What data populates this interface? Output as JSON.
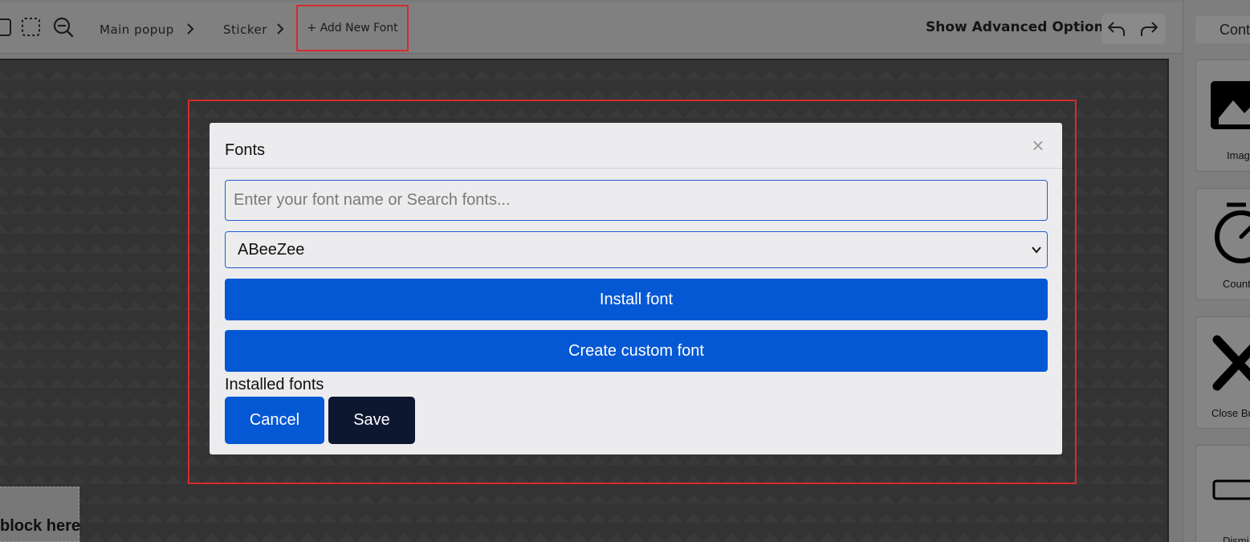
{
  "toolbar": {
    "breadcrumbs": [
      "Main popup",
      "Sticker"
    ],
    "add_font_label": "+ Add New Font",
    "advanced_label": "Show Advanced Options",
    "icons": [
      "square-icon",
      "marquee-select-icon",
      "zoom-out-icon",
      "undo-icon",
      "redo-icon"
    ]
  },
  "canvas": {
    "drop_block_text": "block here"
  },
  "sidebar": {
    "tab_label": "Cont",
    "items": [
      {
        "label": "Image",
        "icon": "image-icon"
      },
      {
        "label": "Count",
        "icon": "stopwatch-icon"
      },
      {
        "label": "Close Bu",
        "icon": "close-icon"
      },
      {
        "label": "Dismi",
        "icon": "dismiss-button-icon"
      }
    ]
  },
  "modal": {
    "title": "Fonts",
    "close_glyph": "×",
    "search_placeholder": "Enter your font name or Search fonts...",
    "search_value": "",
    "selected_font": "ABeeZee",
    "install_label": "Install font",
    "create_label": "Create custom font",
    "installed_label": "Installed fonts",
    "cancel_label": "Cancel",
    "save_label": "Save"
  },
  "colors": {
    "primary": "#0558d4",
    "dark_button": "#0e1730",
    "highlight": "#d42c2c"
  }
}
